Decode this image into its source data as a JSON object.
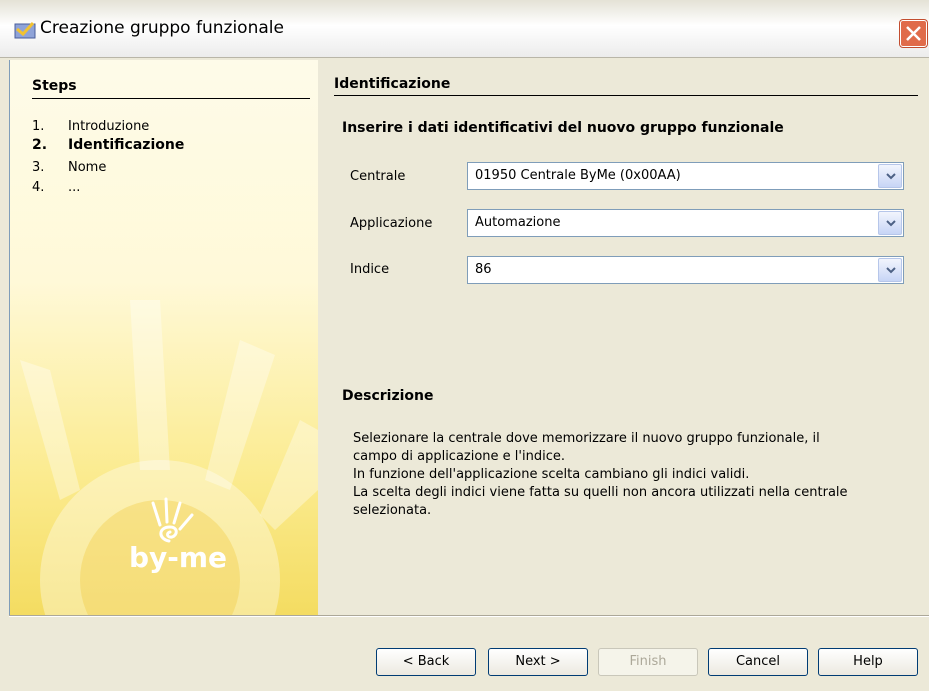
{
  "window": {
    "title": "Creazione gruppo funzionale"
  },
  "steps": {
    "title": "Steps",
    "items": [
      {
        "num": "1.",
        "label": "Introduzione",
        "active": false
      },
      {
        "num": "2.",
        "label": "Identificazione",
        "active": true
      },
      {
        "num": "3.",
        "label": "Nome",
        "active": false
      },
      {
        "num": "4.",
        "label": "...",
        "active": false
      }
    ]
  },
  "logo": {
    "text": "by-me"
  },
  "main": {
    "section_title": "Identificazione",
    "subtitle": "Inserire i dati identificativi del nuovo gruppo funzionale",
    "fields": [
      {
        "label": "Centrale",
        "value": "01950 Centrale ByMe (0x00AA)"
      },
      {
        "label": "Applicazione",
        "value": "Automazione"
      },
      {
        "label": "Indice",
        "value": "86"
      }
    ],
    "description_title": "Descrizione",
    "description_lines": [
      "Selezionare la centrale dove memorizzare il nuovo gruppo funzionale, il",
      "campo di applicazione e l'indice.",
      "In funzione dell'applicazione scelta cambiano gli indici validi.",
      "La scelta degli indici viene fatta su quelli non ancora utilizzati nella centrale",
      "selezionata."
    ]
  },
  "buttons": {
    "back": "< Back",
    "next": "Next >",
    "finish": "Finish",
    "cancel": "Cancel",
    "help": "Help"
  },
  "colors": {
    "accent": "#f4dc61",
    "close": "#e06b4a",
    "border": "#7f9db9"
  }
}
